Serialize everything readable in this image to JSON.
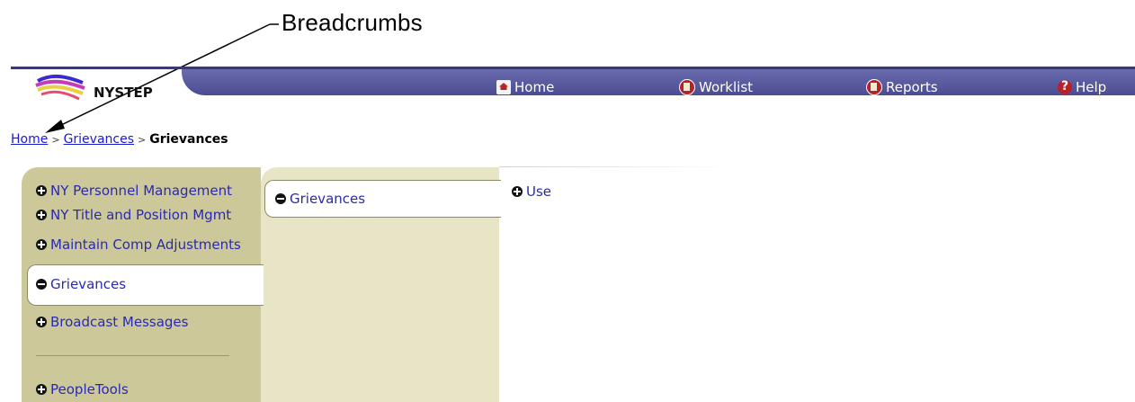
{
  "annotation": {
    "label": "Breadcrumbs"
  },
  "header": {
    "logo_text": "NYSTEP",
    "nav": [
      {
        "label": "Home",
        "icon": "home-icon"
      },
      {
        "label": "Worklist",
        "icon": "worklist-icon"
      },
      {
        "label": "Reports",
        "icon": "reports-icon"
      },
      {
        "label": "Help",
        "icon": "help-icon"
      }
    ]
  },
  "breadcrumb": {
    "items": [
      "Home",
      "Grievances"
    ],
    "current": "Grievances"
  },
  "menu": {
    "col1": [
      "NY Personnel Management",
      "NY Title and Position Mgmt",
      "Maintain Comp Adjustments",
      "Grievances",
      "Broadcast Messages",
      "PeopleTools"
    ],
    "col2": [
      "Grievances"
    ],
    "col3": [
      "Use"
    ]
  },
  "colors": {
    "header_bar": "#5555a0",
    "menu_level1": "#cdc89a",
    "menu_level2": "#e8e4c6",
    "link": "#2a2ab0"
  }
}
